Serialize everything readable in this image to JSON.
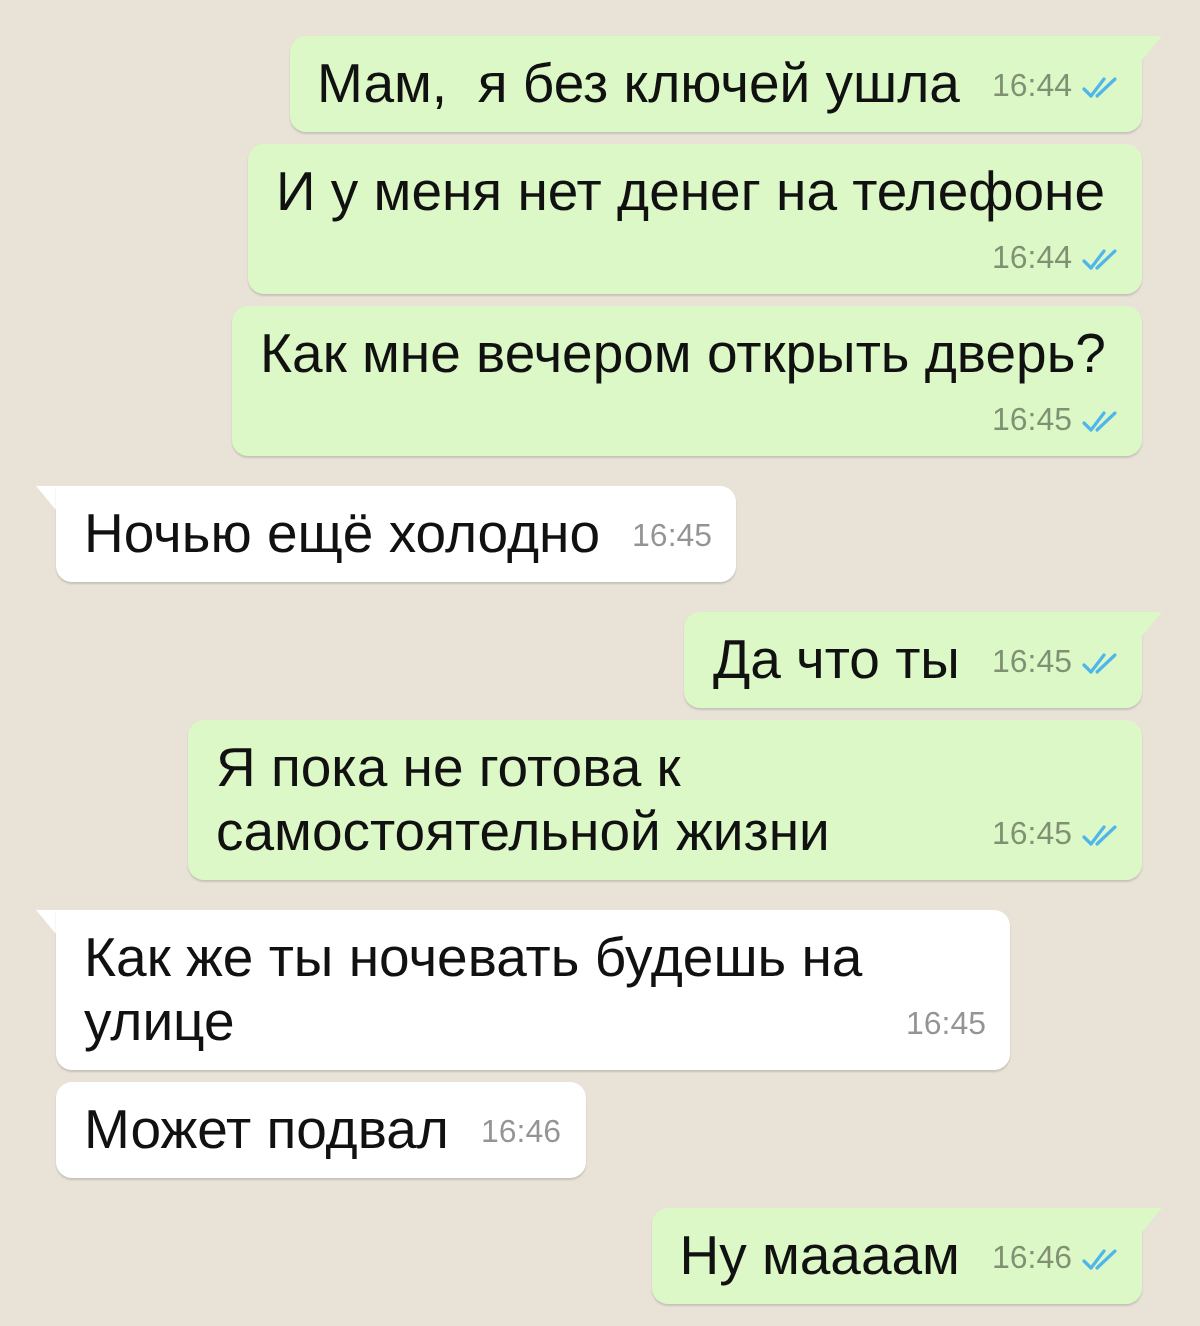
{
  "messages": [
    {
      "kind": "sent",
      "text": "Мам,  я без ключей ушла",
      "time": "16:44",
      "read": true
    },
    {
      "kind": "sent",
      "text": "И у меня нет денег на телефоне",
      "time": "16:44",
      "read": true
    },
    {
      "kind": "sent",
      "text": "Как мне вечером открыть дверь?",
      "time": "16:45",
      "read": true
    },
    {
      "kind": "received",
      "text": "Ночью ещё холодно",
      "time": "16:45"
    },
    {
      "kind": "sent",
      "text": "Да что ты",
      "time": "16:45",
      "read": true
    },
    {
      "kind": "sent",
      "text": "Я пока не готова к самостоятельной жизни",
      "time": "16:45",
      "read": true
    },
    {
      "kind": "received",
      "text": "Как же ты ночевать будешь на улице",
      "time": "16:45"
    },
    {
      "kind": "received",
      "text": "Может подвал",
      "time": "16:46"
    },
    {
      "kind": "sent",
      "text": "Ну маааам",
      "time": "16:46",
      "read": true
    }
  ]
}
